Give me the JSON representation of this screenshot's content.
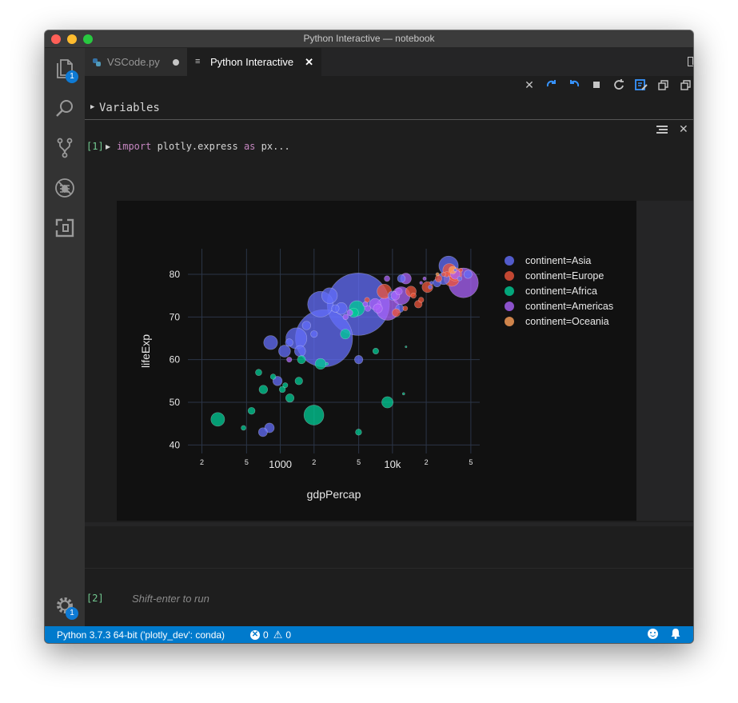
{
  "window": {
    "title": "Python Interactive — notebook"
  },
  "activity_bar": {
    "explorer_badge": "1",
    "settings_badge": "1"
  },
  "tabs": [
    {
      "label": "VSCode.py",
      "modified": true
    },
    {
      "label": "Python Interactive",
      "active": true
    }
  ],
  "variables": {
    "label": "Variables"
  },
  "cell1": {
    "prompt": "[1]",
    "code_keyword": "import",
    "code_module": " plotly.express ",
    "code_as": "as",
    "code_alias": " px..."
  },
  "cell2": {
    "prompt": "[2]",
    "placeholder": "Shift-enter to run"
  },
  "statusbar": {
    "interpreter": "Python 3.7.3 64-bit ('plotly_dev': conda)",
    "errors": "0",
    "warnings": "0"
  },
  "colors": {
    "Asia": "#636efa",
    "Europe": "#ef553b",
    "Africa": "#00cc96",
    "Americas": "#ab63fa",
    "Oceania": "#ffa15a"
  },
  "chart_data": {
    "type": "scatter",
    "xlabel": "gdpPercap",
    "ylabel": "lifeExp",
    "xscale": "log",
    "xlim": [
      150,
      60000
    ],
    "ylim": [
      38,
      86
    ],
    "x_ticks": [
      {
        "value": 200,
        "label": "2"
      },
      {
        "value": 500,
        "label": "5"
      },
      {
        "value": 1000,
        "label": "1000"
      },
      {
        "value": 2000,
        "label": "2"
      },
      {
        "value": 5000,
        "label": "5"
      },
      {
        "value": 10000,
        "label": "10k"
      },
      {
        "value": 20000,
        "label": "2"
      },
      {
        "value": 50000,
        "label": "5"
      }
    ],
    "y_ticks": [
      {
        "value": 40,
        "label": "40"
      },
      {
        "value": 50,
        "label": "50"
      },
      {
        "value": 60,
        "label": "60"
      },
      {
        "value": 70,
        "label": "70"
      },
      {
        "value": 80,
        "label": "80"
      }
    ],
    "legend_position": "top-right",
    "series": [
      {
        "name": "continent=Asia",
        "color": "#636efa",
        "points": [
          [
            4959,
            73
          ],
          [
            2452,
            65
          ],
          [
            2280,
            73
          ],
          [
            2749,
            75
          ],
          [
            1391,
            65
          ],
          [
            820,
            64
          ],
          [
            1091,
            62
          ],
          [
            944,
            55
          ],
          [
            1713,
            68
          ],
          [
            3095,
            72
          ],
          [
            5000,
            60
          ],
          [
            1200,
            64
          ],
          [
            11605,
            72
          ],
          [
            12000,
            79
          ],
          [
            10000,
            75
          ],
          [
            3500,
            72
          ],
          [
            1500,
            62
          ],
          [
            2000,
            66
          ],
          [
            800,
            44
          ],
          [
            700,
            43
          ],
          [
            31656,
            82
          ],
          [
            28604,
            79
          ],
          [
            25000,
            78
          ],
          [
            47143,
            80
          ],
          [
            39725,
            79
          ],
          [
            36319,
            81
          ],
          [
            22316,
            78
          ],
          [
            21655,
            77
          ]
        ],
        "sizes": [
          1319,
          1110,
          223,
          84,
          150,
          66,
          48,
          30,
          25,
          20,
          24,
          20,
          23,
          21,
          28,
          47,
          42,
          16,
          32,
          27,
          128,
          49,
          22,
          23,
          7,
          3,
          4,
          5
        ]
      },
      {
        "name": "continent=Europe",
        "color": "#ef553b",
        "points": [
          [
            33692,
            79
          ],
          [
            36126,
            80
          ],
          [
            32170,
            81
          ],
          [
            30470,
            80
          ],
          [
            25768,
            79
          ],
          [
            40676,
            81
          ],
          [
            28569,
            80
          ],
          [
            15390,
            75
          ],
          [
            14619,
            76
          ],
          [
            10808,
            71
          ],
          [
            18009,
            74
          ],
          [
            13000,
            72
          ],
          [
            8458,
            76
          ],
          [
            20509,
            77
          ],
          [
            17000,
            73
          ],
          [
            5937,
            74
          ]
        ],
        "sizes": [
          82,
          61,
          58,
          10,
          16,
          5,
          6,
          10,
          38,
          22,
          10,
          8,
          71,
          40,
          20,
          9
        ]
      },
      {
        "name": "continent=Africa",
        "color": "#00cc96",
        "points": [
          [
            1993,
            47
          ],
          [
            2283,
            59
          ],
          [
            4814,
            72
          ],
          [
            9020,
            50
          ],
          [
            277,
            46
          ],
          [
            470,
            44
          ],
          [
            554,
            48
          ],
          [
            1217,
            51
          ],
          [
            863,
            56
          ],
          [
            1043,
            53
          ],
          [
            706,
            53
          ],
          [
            1463,
            55
          ],
          [
            4985,
            43
          ],
          [
            13206,
            63
          ],
          [
            2602,
            59
          ],
          [
            1544,
            60
          ],
          [
            641,
            57
          ],
          [
            4513,
            71
          ],
          [
            12570,
            52
          ],
          [
            1107,
            54
          ],
          [
            3801,
            66
          ],
          [
            7093,
            62
          ]
        ],
        "sizes": [
          135,
          40,
          80,
          44,
          64,
          8,
          17,
          24,
          10,
          13,
          25,
          20,
          13,
          1,
          3,
          23,
          14,
          30,
          2,
          9,
          33,
          12
        ]
      },
      {
        "name": "continent=Americas",
        "color": "#ab63fa",
        "points": [
          [
            42951,
            78
          ],
          [
            36319,
            80
          ],
          [
            9065,
            72
          ],
          [
            11977,
            75
          ],
          [
            13172,
            79
          ],
          [
            7006,
            73
          ],
          [
            11416,
            76
          ],
          [
            3822,
            70
          ],
          [
            5728,
            73
          ],
          [
            7408,
            72
          ],
          [
            8948,
            79
          ],
          [
            6025,
            72
          ],
          [
            19328,
            79
          ],
          [
            10611,
            75
          ],
          [
            4172,
            71
          ],
          [
            18008,
            78
          ],
          [
            1201,
            60
          ]
        ],
        "sizes": [
          301,
          33,
          190,
          108,
          40,
          44,
          16,
          10,
          9,
          28,
          11,
          12,
          4,
          26,
          12,
          3,
          9
        ]
      },
      {
        "name": "continent=Oceania",
        "color": "#ffa15a",
        "points": [
          [
            34435,
            81
          ],
          [
            25185,
            80
          ]
        ],
        "sizes": [
          20,
          4
        ]
      }
    ]
  }
}
